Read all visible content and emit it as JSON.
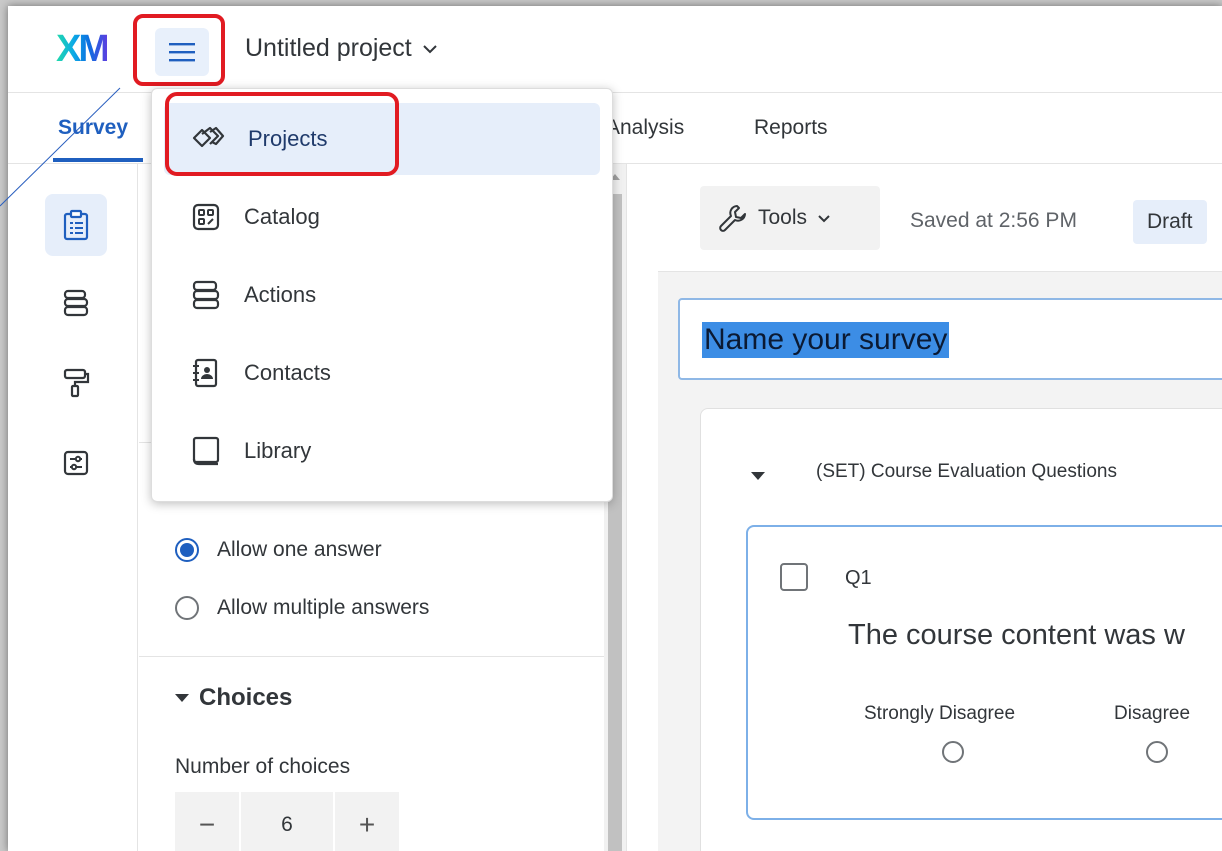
{
  "header": {
    "logo": "XM",
    "project_title": "Untitled project"
  },
  "tabs": {
    "survey": "Survey",
    "analysis": "Analysis",
    "reports": "Reports"
  },
  "menu": {
    "items": [
      {
        "label": "Projects",
        "icon": "projects-icon",
        "selected": true
      },
      {
        "label": "Catalog",
        "icon": "catalog-icon"
      },
      {
        "label": "Actions",
        "icon": "actions-icon"
      },
      {
        "label": "Contacts",
        "icon": "contacts-icon"
      },
      {
        "label": "Library",
        "icon": "library-icon"
      }
    ]
  },
  "left_panel": {
    "answer_options": [
      {
        "label": "Allow one answer",
        "checked": true
      },
      {
        "label": "Allow multiple answers",
        "checked": false
      }
    ],
    "choices_heading": "Choices",
    "number_of_choices_label": "Number of choices",
    "number_of_choices_value": "6",
    "minus": "−",
    "plus": "+"
  },
  "toolbar": {
    "tools_label": "Tools",
    "saved_text": "Saved at 2:56 PM",
    "status": "Draft"
  },
  "survey": {
    "name_placeholder": "Name your survey",
    "block_title": "(SET) Course Evaluation Questions",
    "question": {
      "id": "Q1",
      "text": "The course content was w",
      "scale": [
        "Strongly Disagree",
        "Disagree"
      ]
    }
  },
  "colors": {
    "accent": "#1f5fbf",
    "highlight_annotation": "#e11b22",
    "selection": "#3c8de5"
  }
}
